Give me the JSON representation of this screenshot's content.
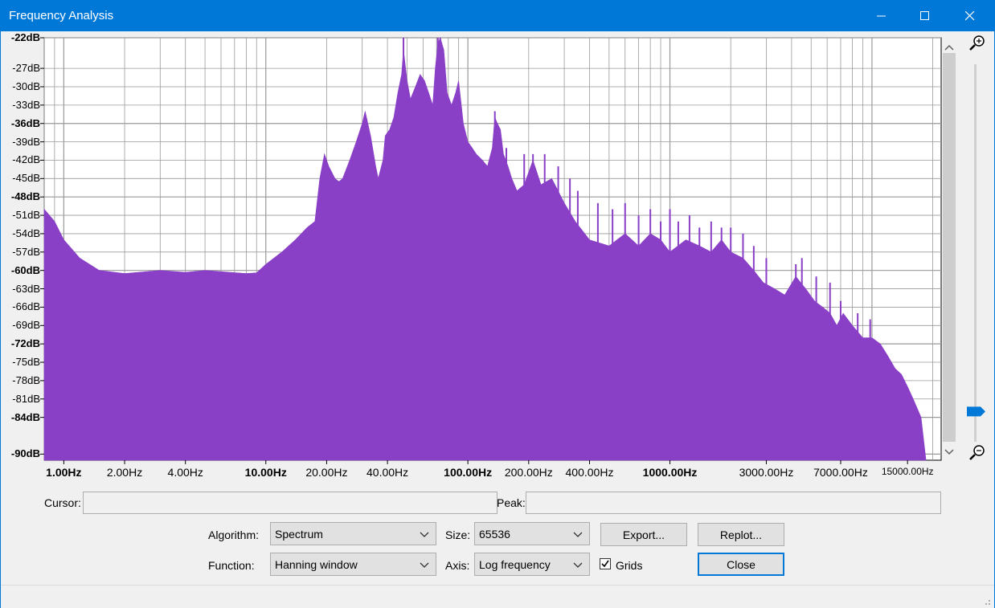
{
  "window": {
    "title": "Frequency Analysis"
  },
  "colors": {
    "titlebar": "#0078d7",
    "spectrum": "#8a3fc7",
    "grid": "#999999",
    "accent": "#0078d7"
  },
  "chart_data": {
    "type": "area",
    "x_scale": "log",
    "x_unit": "Hz",
    "xlim": [
      0.8,
      22000
    ],
    "ylim": [
      -91,
      -22
    ],
    "y_tick_labels": [
      {
        "v": -22,
        "t": "-22dB",
        "bold": true
      },
      {
        "v": -27,
        "t": "-27dB",
        "bold": false
      },
      {
        "v": -30,
        "t": "-30dB",
        "bold": false
      },
      {
        "v": -33,
        "t": "-33dB",
        "bold": false
      },
      {
        "v": -36,
        "t": "-36dB",
        "bold": true
      },
      {
        "v": -39,
        "t": "-39dB",
        "bold": false
      },
      {
        "v": -42,
        "t": "-42dB",
        "bold": false
      },
      {
        "v": -45,
        "t": "-45dB",
        "bold": false
      },
      {
        "v": -48,
        "t": "-48dB",
        "bold": true
      },
      {
        "v": -51,
        "t": "-51dB",
        "bold": false
      },
      {
        "v": -54,
        "t": "-54dB",
        "bold": false
      },
      {
        "v": -57,
        "t": "-57dB",
        "bold": false
      },
      {
        "v": -60,
        "t": "-60dB",
        "bold": true
      },
      {
        "v": -63,
        "t": "-63dB",
        "bold": false
      },
      {
        "v": -66,
        "t": "-66dB",
        "bold": false
      },
      {
        "v": -69,
        "t": "-69dB",
        "bold": false
      },
      {
        "v": -72,
        "t": "-72dB",
        "bold": true
      },
      {
        "v": -75,
        "t": "-75dB",
        "bold": false
      },
      {
        "v": -78,
        "t": "-78dB",
        "bold": false
      },
      {
        "v": -81,
        "t": "-81dB",
        "bold": false
      },
      {
        "v": -84,
        "t": "-84dB",
        "bold": true
      },
      {
        "v": -90,
        "t": "-90dB",
        "bold": true
      }
    ],
    "x_tick_labels": [
      {
        "v": 1,
        "t": "1.00Hz",
        "bold": true
      },
      {
        "v": 2,
        "t": "2.00Hz",
        "bold": false
      },
      {
        "v": 4,
        "t": "4.00Hz",
        "bold": false
      },
      {
        "v": 10,
        "t": "10.00Hz",
        "bold": true
      },
      {
        "v": 20,
        "t": "20.00Hz",
        "bold": false
      },
      {
        "v": 40,
        "t": "40.00Hz",
        "bold": false
      },
      {
        "v": 100,
        "t": "100.00Hz",
        "bold": true
      },
      {
        "v": 200,
        "t": "200.00Hz",
        "bold": false
      },
      {
        "v": 400,
        "t": "400.00Hz",
        "bold": false
      },
      {
        "v": 1000,
        "t": "1000.00Hz",
        "bold": true
      },
      {
        "v": 3000,
        "t": "3000.00Hz",
        "bold": false
      },
      {
        "v": 7000,
        "t": "7000.00Hz",
        "bold": false
      },
      {
        "v": 15000,
        "t": "15000.00Hz",
        "bold": false,
        "small": true
      }
    ],
    "grid": true,
    "series": [
      {
        "points": [
          [
            0.8,
            -50
          ],
          [
            0.9,
            -52
          ],
          [
            1.0,
            -55
          ],
          [
            1.2,
            -58
          ],
          [
            1.5,
            -60
          ],
          [
            2.0,
            -60.5
          ],
          [
            3.0,
            -60
          ],
          [
            4.0,
            -60.3
          ],
          [
            5.0,
            -60
          ],
          [
            6.0,
            -60.2
          ],
          [
            8.0,
            -60.5
          ],
          [
            9.0,
            -60.4
          ],
          [
            10.0,
            -59
          ],
          [
            12.0,
            -57
          ],
          [
            14.0,
            -55
          ],
          [
            16.0,
            -53
          ],
          [
            17.5,
            -52
          ],
          [
            18.5,
            -45
          ],
          [
            19.5,
            -41
          ],
          [
            20.5,
            -43
          ],
          [
            22,
            -45
          ],
          [
            23,
            -45.5
          ],
          [
            24,
            -45
          ],
          [
            26,
            -42
          ],
          [
            28,
            -39
          ],
          [
            30,
            -36
          ],
          [
            31,
            -34
          ],
          [
            33,
            -38
          ],
          [
            35,
            -43
          ],
          [
            36,
            -45
          ],
          [
            38,
            -42
          ],
          [
            39,
            -38
          ],
          [
            41,
            -37
          ],
          [
            43,
            -35
          ],
          [
            45,
            -31
          ],
          [
            47,
            -28
          ],
          [
            48,
            -24
          ],
          [
            50,
            -29
          ],
          [
            52,
            -32
          ],
          [
            55,
            -30
          ],
          [
            58,
            -28
          ],
          [
            61,
            -29
          ],
          [
            64,
            -31
          ],
          [
            67,
            -33
          ],
          [
            69,
            -27
          ],
          [
            71,
            -23
          ],
          [
            73,
            -22
          ],
          [
            76,
            -24
          ],
          [
            79,
            -31
          ],
          [
            83,
            -33
          ],
          [
            87,
            -31
          ],
          [
            90,
            -29
          ],
          [
            95,
            -36
          ],
          [
            100,
            -39
          ],
          [
            105,
            -40
          ],
          [
            110,
            -41
          ],
          [
            118,
            -42
          ],
          [
            125,
            -43
          ],
          [
            132,
            -40
          ],
          [
            136,
            -35
          ],
          [
            140,
            -36
          ],
          [
            145,
            -37
          ],
          [
            150,
            -41
          ],
          [
            158,
            -43
          ],
          [
            165,
            -45
          ],
          [
            175,
            -47
          ],
          [
            190,
            -46
          ],
          [
            210,
            -42
          ],
          [
            230,
            -46
          ],
          [
            260,
            -45
          ],
          [
            300,
            -49
          ],
          [
            340,
            -52
          ],
          [
            400,
            -55
          ],
          [
            500,
            -56
          ],
          [
            600,
            -54
          ],
          [
            700,
            -56
          ],
          [
            800,
            -54
          ],
          [
            900,
            -55
          ],
          [
            1000,
            -57
          ],
          [
            1200,
            -55
          ],
          [
            1400,
            -56
          ],
          [
            1600,
            -57
          ],
          [
            1800,
            -55
          ],
          [
            2000,
            -57
          ],
          [
            2300,
            -58
          ],
          [
            2600,
            -60
          ],
          [
            2900,
            -62
          ],
          [
            3300,
            -63
          ],
          [
            3700,
            -64
          ],
          [
            4200,
            -61
          ],
          [
            4700,
            -63
          ],
          [
            5200,
            -65
          ],
          [
            5700,
            -66
          ],
          [
            6200,
            -67
          ],
          [
            6700,
            -69
          ],
          [
            7200,
            -67
          ],
          [
            8000,
            -69
          ],
          [
            9000,
            -71
          ],
          [
            10000,
            -71
          ],
          [
            11000,
            -72
          ],
          [
            12000,
            -74
          ],
          [
            13000,
            -76
          ],
          [
            14000,
            -77
          ],
          [
            15000,
            -79
          ],
          [
            16000,
            -81
          ],
          [
            17500,
            -84
          ],
          [
            18500,
            -91
          ]
        ],
        "spikes": [
          [
            48,
            -22
          ],
          [
            71,
            -22
          ],
          [
            73,
            -22
          ],
          [
            136,
            -34
          ],
          [
            155,
            -40
          ],
          [
            190,
            -41
          ],
          [
            210,
            -41
          ],
          [
            240,
            -41
          ],
          [
            280,
            -43
          ],
          [
            320,
            -45
          ],
          [
            350,
            -47
          ],
          [
            440,
            -49
          ],
          [
            520,
            -50
          ],
          [
            600,
            -49
          ],
          [
            700,
            -51
          ],
          [
            800,
            -50
          ],
          [
            900,
            -52
          ],
          [
            1000,
            -50
          ],
          [
            1100,
            -52
          ],
          [
            1250,
            -51
          ],
          [
            1400,
            -53
          ],
          [
            1600,
            -52
          ],
          [
            1800,
            -53
          ],
          [
            2000,
            -53
          ],
          [
            2300,
            -54
          ],
          [
            2600,
            -56
          ],
          [
            3000,
            -58
          ],
          [
            4200,
            -59
          ],
          [
            4500,
            -58
          ],
          [
            5300,
            -61
          ],
          [
            6200,
            -62
          ],
          [
            7000,
            -65
          ],
          [
            8500,
            -67
          ],
          [
            9800,
            -68
          ]
        ]
      }
    ]
  },
  "cursor": {
    "label": "Cursor:",
    "value": ""
  },
  "peak": {
    "label": "Peak:",
    "value": ""
  },
  "algorithm": {
    "label": "Algorithm:",
    "value": "Spectrum"
  },
  "size": {
    "label": "Size:",
    "value": "65536"
  },
  "function": {
    "label": "Function:",
    "value": "Hanning window"
  },
  "axis": {
    "label": "Axis:",
    "value": "Log frequency"
  },
  "grids": {
    "label": "Grids",
    "checked": true
  },
  "buttons": {
    "export": "Export...",
    "replot": "Replot...",
    "close": "Close"
  },
  "zoom": {
    "level": 0.92
  }
}
